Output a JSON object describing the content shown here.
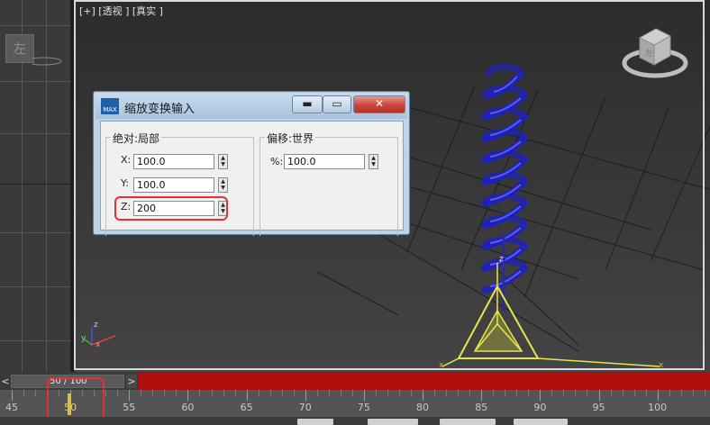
{
  "viewport": {
    "label": "[+] [透视 ] [真实 ]",
    "left_cube_label": "左",
    "viewcube_label": "左"
  },
  "dialog": {
    "title": "缩放变换输入",
    "logo_text": "MAX",
    "min_glyph": "▬",
    "max_glyph": "▭",
    "close_glyph": "✕",
    "absolute_group": {
      "title": "绝对:局部",
      "x_label": "X:",
      "x_value": "100.0",
      "y_label": "Y:",
      "y_value": "100.0",
      "z_label": "Z:",
      "z_value": "200"
    },
    "offset_group": {
      "title": "偏移:世界",
      "pct_label": "%:",
      "pct_value": "100.0"
    }
  },
  "axis_gizmo": {
    "x": "x",
    "y": "y",
    "z": "z"
  },
  "gizmo_labels": {
    "z": "z",
    "x_left": "x",
    "x_right": "x"
  },
  "timeline": {
    "prev_glyph": "<",
    "next_glyph": ">",
    "frame_indicator": "50 / 100",
    "current_frame": 50,
    "total_frames": 100,
    "ruler_labels": [
      "45",
      "50",
      "55",
      "60",
      "65",
      "70",
      "75",
      "80",
      "85",
      "90",
      "95",
      "100"
    ]
  },
  "colors": {
    "spring": "#1f22b8",
    "gizmo": "#e6e64a",
    "highlight": "#e53030",
    "timeline_red": "#b20d0d"
  }
}
